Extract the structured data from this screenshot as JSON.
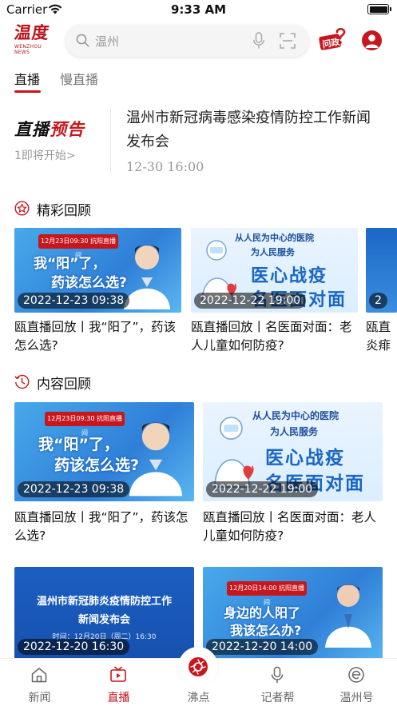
{
  "status_bar": {
    "carrier": "Carrier",
    "time": "9:33 AM"
  },
  "header": {
    "logo_glyphs": "温度",
    "logo_sub": "WENZHOU NEWS",
    "search_text": "温州",
    "wenzheng_label": "问政"
  },
  "tabs": [
    {
      "label": "直播",
      "active": true
    },
    {
      "label": "慢直播",
      "active": false
    }
  ],
  "preview": {
    "title_black": "直播",
    "title_red": "预告",
    "subtitle": "1即将开始>",
    "headline": "温州市新冠病毒感染疫情防控工作新闻发布会",
    "time": "12-30  16:00"
  },
  "highlights": {
    "label": "精彩回顾",
    "cards": [
      {
        "date": "2022-12-23 09:38",
        "title": "瓯直播回放丨我“阳了”，药该怎么选?",
        "art": {
          "banner": "12月23日09:30 抗阳直播间",
          "big1": "我“阳”了，",
          "big2": "药该怎么选?"
        }
      },
      {
        "date": "2022-12-22 19:00",
        "title": "瓯直播回放丨名医面对面：老人儿童如何防疫?",
        "art": {
          "top1": "从人民为中心的医院",
          "top2": "为人民服务",
          "big1": "医心战疫",
          "big2": "名医面对面"
        }
      },
      {
        "date": "2",
        "title": "瓯直炎痱"
      }
    ]
  },
  "content_review": {
    "label": "内容回顾",
    "cards": [
      {
        "date": "2022-12-23 09:38",
        "title": "瓯直播回放丨我“阳了”，药该怎么选?",
        "art": {
          "banner": "12月23日09:30 抗阳直播间",
          "big1": "我“阳”了，",
          "big2": "药该怎么选?"
        }
      },
      {
        "date": "2022-12-22 19:00",
        "title": "瓯直播回放丨名医面对面：老人儿童如何防疫?",
        "art": {
          "top1": "从人民为中心的医院",
          "top2": "为人民服务",
          "big1": "医心战疫",
          "big2": "名医面对面"
        }
      },
      {
        "date": "2022-12-20 16:30",
        "title": "",
        "art": {
          "t1": "温州市新冠肺炎疫情防控工作",
          "t2": "新闻发布会",
          "t3": "时间：12月20日（周二）16:30"
        }
      },
      {
        "date": "2022-12-20 14:00",
        "title": "",
        "art": {
          "banner": "12月20日14:00 抗阳直播间",
          "big1": "身边的人阳了",
          "big2": "我该怎么办?"
        }
      }
    ]
  },
  "bottom_nav": [
    {
      "label": "新闻",
      "icon": "home-icon",
      "active": false
    },
    {
      "label": "直播",
      "icon": "tv-icon",
      "active": true
    },
    {
      "label": "沸点",
      "icon": "aperture-icon",
      "active": false
    },
    {
      "label": "记者帮",
      "icon": "mic-icon",
      "active": false
    },
    {
      "label": "温州号",
      "icon": "e-icon",
      "active": false
    }
  ],
  "colors": {
    "brand_red": "#c8161d",
    "thumb_blue": "#2f7fd8"
  }
}
